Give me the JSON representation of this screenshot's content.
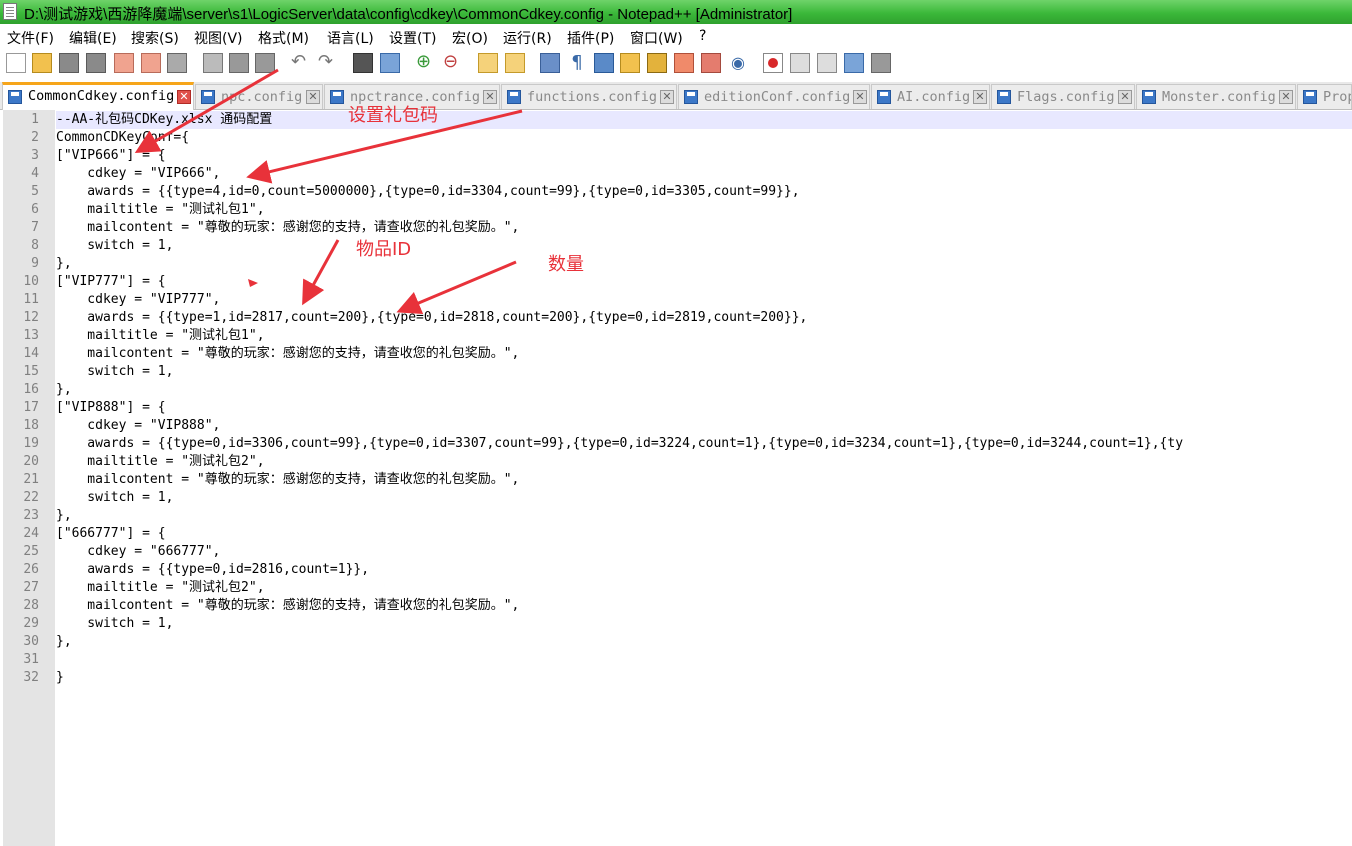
{
  "window": {
    "title": "D:\\测试游戏\\西游降魔端\\server\\s1\\LogicServer\\data\\config\\cdkey\\CommonCdkey.config - Notepad++ [Administrator]"
  },
  "menu": [
    "文件(F)",
    "编辑(E)",
    "搜索(S)",
    "视图(V)",
    "格式(M)",
    "语言(L)",
    "设置(T)",
    "宏(O)",
    "运行(R)",
    "插件(P)",
    "窗口(W)",
    "?"
  ],
  "tabs": [
    "CommonCdkey.config",
    "npc.config",
    "npctrance.config",
    "functions.config",
    "editionConf.config",
    "AI.config",
    "Flags.config",
    "Monster.config",
    "Prop"
  ],
  "editor": {
    "line_numbers": [
      "1",
      "2",
      "3",
      "4",
      "5",
      "6",
      "7",
      "8",
      "9",
      "10",
      "11",
      "12",
      "13",
      "14",
      "15",
      "16",
      "17",
      "18",
      "19",
      "20",
      "21",
      "22",
      "23",
      "24",
      "25",
      "26",
      "27",
      "28",
      "29",
      "30",
      "31",
      "32"
    ],
    "lines": [
      "--AA-礼包码CDKey.xlsx 通码配置",
      "CommonCDKeyConf={",
      "[\"VIP666\"] = {",
      "    cdkey = \"VIP666\",",
      "    awards = {{type=4,id=0,count=5000000},{type=0,id=3304,count=99},{type=0,id=3305,count=99}},",
      "    mailtitle = \"测试礼包1\",",
      "    mailcontent = \"尊敬的玩家：感谢您的支持，请查收您的礼包奖励。\",",
      "    switch = 1,",
      "},",
      "[\"VIP777\"] = {",
      "    cdkey = \"VIP777\",",
      "    awards = {{type=1,id=2817,count=200},{type=0,id=2818,count=200},{type=0,id=2819,count=200}},",
      "    mailtitle = \"测试礼包1\",",
      "    mailcontent = \"尊敬的玩家：感谢您的支持，请查收您的礼包奖励。\",",
      "    switch = 1,",
      "},",
      "[\"VIP888\"] = {",
      "    cdkey = \"VIP888\",",
      "    awards = {{type=0,id=3306,count=99},{type=0,id=3307,count=99},{type=0,id=3224,count=1},{type=0,id=3234,count=1},{type=0,id=3244,count=1},{ty",
      "    mailtitle = \"测试礼包2\",",
      "    mailcontent = \"尊敬的玩家：感谢您的支持，请查收您的礼包奖励。\",",
      "    switch = 1,",
      "},",
      "[\"666777\"] = {",
      "    cdkey = \"666777\",",
      "    awards = {{type=0,id=2816,count=1}},",
      "    mailtitle = \"测试礼包2\",",
      "    mailcontent = \"尊敬的玩家：感谢您的支持，请查收您的礼包奖励。\",",
      "    switch = 1,",
      "},",
      "",
      "}"
    ]
  },
  "annotations": {
    "gift_code": "设置礼包码",
    "item_id": "物品ID",
    "quantity": "数量"
  },
  "colors": {
    "titlebar": "#3bb83a",
    "annotation": "#e8323a",
    "tab_accent": "#f6a51a",
    "gutter": "#e4e4e4"
  }
}
